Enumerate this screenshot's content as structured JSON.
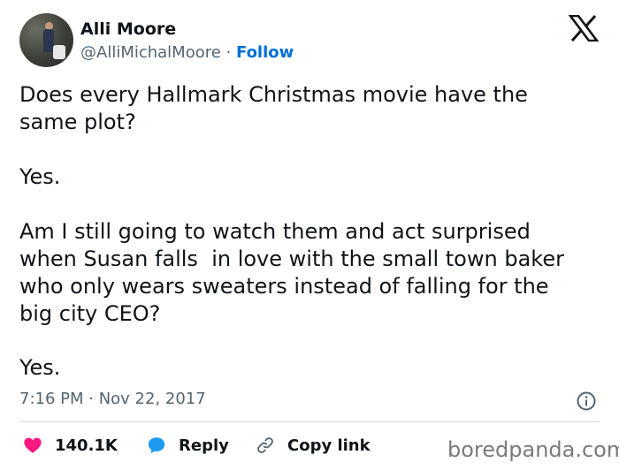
{
  "tweet": {
    "author_name": "Alli Moore",
    "handle": "@AlliMichalMoore",
    "separator": " · ",
    "follow_label": "Follow",
    "paragraphs": [
      "Does every Hallmark Christmas movie have the\nsame plot?",
      "Yes.",
      "Am I still going to watch them and act surprised\nwhen Susan falls  in love with the small town baker\nwho only wears sweaters instead of falling for the\nbig city CEO?",
      "Yes."
    ],
    "timestamp": "7:16 PM · Nov 22, 2017",
    "likes": "140.1K",
    "reply_label": "Reply",
    "copy_link_label": "Copy link"
  },
  "watermark": "boredpanda.com",
  "colors": {
    "like": "#f91880",
    "reply": "#1d9bf0",
    "follow": "#006fd6",
    "muted": "#536471"
  },
  "icons": {
    "brand": "x-logo-icon",
    "info": "info-icon",
    "like": "heart-icon",
    "reply": "speech-bubble-icon",
    "copy": "link-icon"
  }
}
